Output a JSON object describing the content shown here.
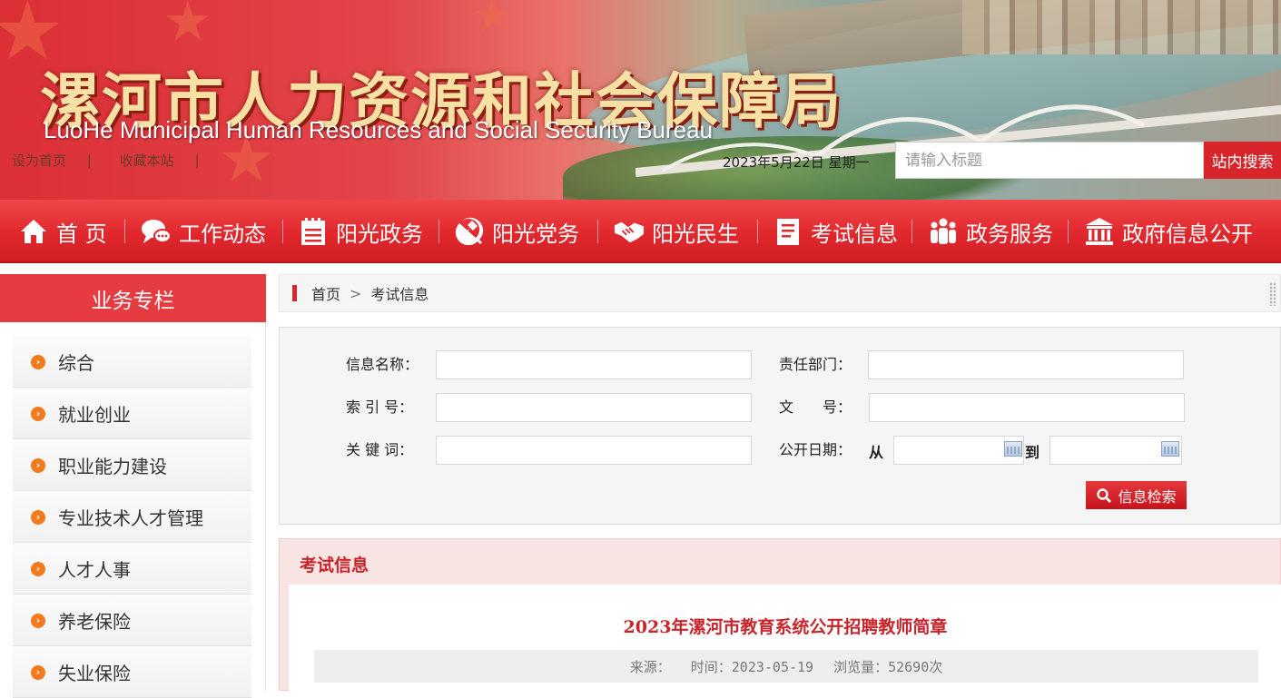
{
  "header": {
    "title_cn": "漯河市人力资源和社会保障局",
    "title_en": "LuoHe Municipal Human Resources and Social Security Bureau",
    "links": [
      "设为首页",
      "收藏本站"
    ],
    "separator": "|",
    "date": "2023年5月22日 星期一",
    "search": {
      "placeholder": "请输入标题",
      "button": "站内搜索"
    }
  },
  "nav": {
    "items": [
      {
        "label": "首 页",
        "icon": "home-icon"
      },
      {
        "label": "工作动态",
        "icon": "chat-bubble-icon"
      },
      {
        "label": "阳光政务",
        "icon": "document-list-icon"
      },
      {
        "label": "阳光党务",
        "icon": "party-emblem-icon"
      },
      {
        "label": "阳光民生",
        "icon": "handshake-icon"
      },
      {
        "label": "考试信息",
        "icon": "notepad-icon"
      },
      {
        "label": "政务服务",
        "icon": "people-icon"
      },
      {
        "label": "政府信息公开",
        "icon": "government-building-icon"
      }
    ]
  },
  "sidebar": {
    "title": "业务专栏",
    "items": [
      "综合",
      "就业创业",
      "职业能力建设",
      "专业技术人才管理",
      "人才人事",
      "养老保险",
      "失业保险"
    ]
  },
  "breadcrumb": {
    "home": "首页",
    "separator": ">",
    "current": "考试信息"
  },
  "form": {
    "info_name_label": "信息名称：",
    "dept_label": "责任部门：",
    "index_label": "索 引 号：",
    "doc_no_label": "文　　号：",
    "keyword_label": "关 键 词：",
    "date_label": "公开日期：",
    "from_label": "从",
    "to_label": "到",
    "search_button": "信息检索"
  },
  "content": {
    "section_title": "考试信息",
    "article_title": "2023年漯河市教育系统公开招聘教师简章",
    "source_label": "来源：",
    "time_text": "时间：2023-05-19",
    "views_text": "浏览量：52690次"
  },
  "colors": {
    "primary_red": "#d8252b",
    "bullet_orange": "#f57a1d",
    "title_gold": "#f6e0a4"
  }
}
